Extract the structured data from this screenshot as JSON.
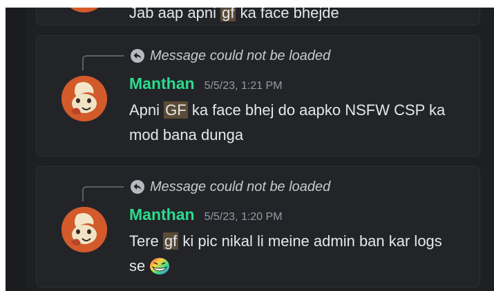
{
  "previous_message": {
    "partial_text_1": "Jab aap apni ",
    "highlight": "gf",
    "partial_text_2": " ka face bhejde"
  },
  "messages": [
    {
      "reply_notice": "Message could not be loaded",
      "username": "Manthan",
      "timestamp": "5/5/23, 1:21 PM",
      "text_before": "Apni ",
      "highlight": "GF",
      "text_after": " ka face bhej do aapko NSFW CSP ka mod bana dunga"
    },
    {
      "reply_notice": "Message could not be loaded",
      "username": "Manthan",
      "timestamp": "5/5/23, 1:20 PM",
      "text_before": "Tere ",
      "highlight": "gf",
      "text_after": " ki pic nikal li meine admin ban kar logs se ",
      "emoji": "trollface-emoji"
    }
  ],
  "colors": {
    "username": "#2bdc8e",
    "highlight": "#5b4c37",
    "background": "#1e1f22",
    "card": "#232428"
  }
}
